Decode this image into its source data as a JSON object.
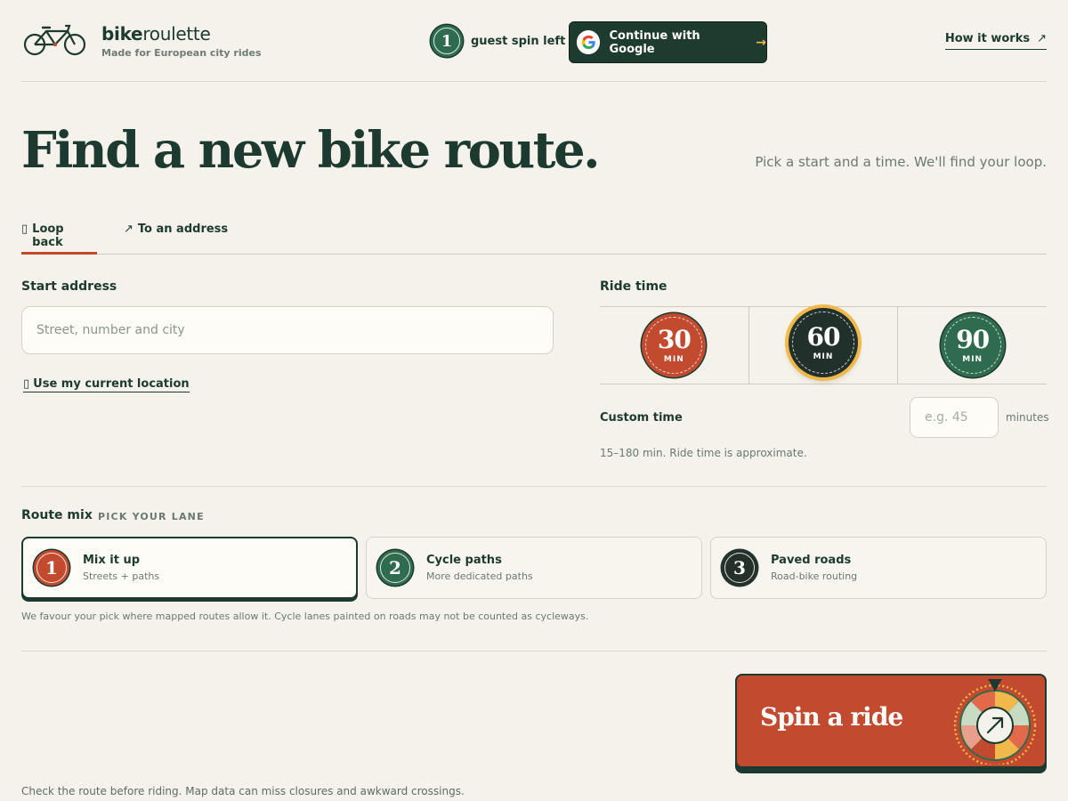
{
  "header": {
    "brand_bold": "bike",
    "brand_light": "roulette",
    "tagline": "Made for European city rides",
    "guest_count": "1",
    "guest_text": "guest spin left",
    "google_label": "Continue with Google",
    "how_label": "How it works"
  },
  "hero": {
    "title": "Find a new bike route.",
    "subtitle": "Pick a start and a time. We'll find your loop."
  },
  "tabs": [
    {
      "icon": "▯",
      "label": "Loop back",
      "active": true
    },
    {
      "icon": "↗",
      "label": "To an address",
      "active": false
    }
  ],
  "start": {
    "label": "Start address",
    "placeholder": "Street, number and city",
    "location_icon": "▯",
    "location_link": "Use my current location"
  },
  "ride_time": {
    "label": "Ride time",
    "options": [
      {
        "value": "30",
        "unit": "MIN",
        "color": "#c24a2e"
      },
      {
        "value": "60",
        "unit": "MIN",
        "color": "#22302b",
        "selected": true
      },
      {
        "value": "90",
        "unit": "MIN",
        "color": "#2f6b4d"
      }
    ],
    "custom_label": "Custom time",
    "custom_placeholder": "e.g. 45",
    "custom_unit": "minutes",
    "note": "15–180 min. Ride time is approximate."
  },
  "route_mix": {
    "title": "Route mix",
    "subtitle": "PICK YOUR LANE",
    "options": [
      {
        "num": "1",
        "name": "Mix it up",
        "desc": "Streets + paths",
        "selected": true
      },
      {
        "num": "2",
        "name": "Cycle paths",
        "desc": "More dedicated paths"
      },
      {
        "num": "3",
        "name": "Paved roads",
        "desc": "Road-bike routing"
      }
    ],
    "note": "We favour your pick where mapped routes allow it. Cycle lanes painted on roads may not be counted as cycleways."
  },
  "spin": {
    "label": "Spin a ride"
  },
  "footer": {
    "note": "Check the route before riding. Map data can miss closures and awkward crossings."
  },
  "colors": {
    "accent": "#c24a2e",
    "brand": "#1d3a30",
    "gold": "#f2b84b",
    "green": "#2f6b4d",
    "background": "#f4f2ea"
  }
}
